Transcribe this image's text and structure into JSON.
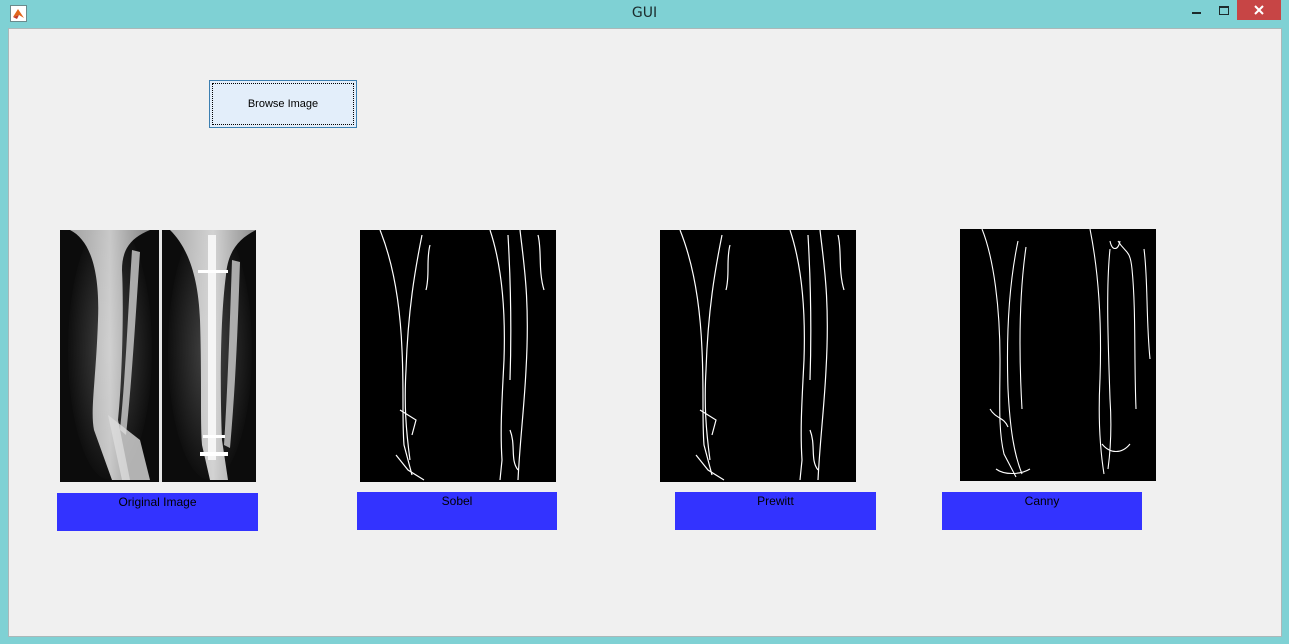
{
  "window": {
    "title": "GUI",
    "icon": "matlab-icon",
    "controls": [
      "minimize-icon",
      "maximize-icon",
      "close-icon"
    ]
  },
  "toolbar": {
    "browse_label": "Browse Image"
  },
  "panels": [
    {
      "image": "original-xray",
      "label": "Original Image"
    },
    {
      "image": "sobel-edges",
      "label": "Sobel"
    },
    {
      "image": "prewitt-edges",
      "label": "Prewitt"
    },
    {
      "image": "canny-edges",
      "label": "Canny"
    }
  ],
  "colors": {
    "title_bar": "#7fd1d4",
    "client_bg": "#f0f0f0",
    "label_bg": "#3333ff",
    "close_button": "#c74545",
    "browse_button": "#e3eefa"
  }
}
